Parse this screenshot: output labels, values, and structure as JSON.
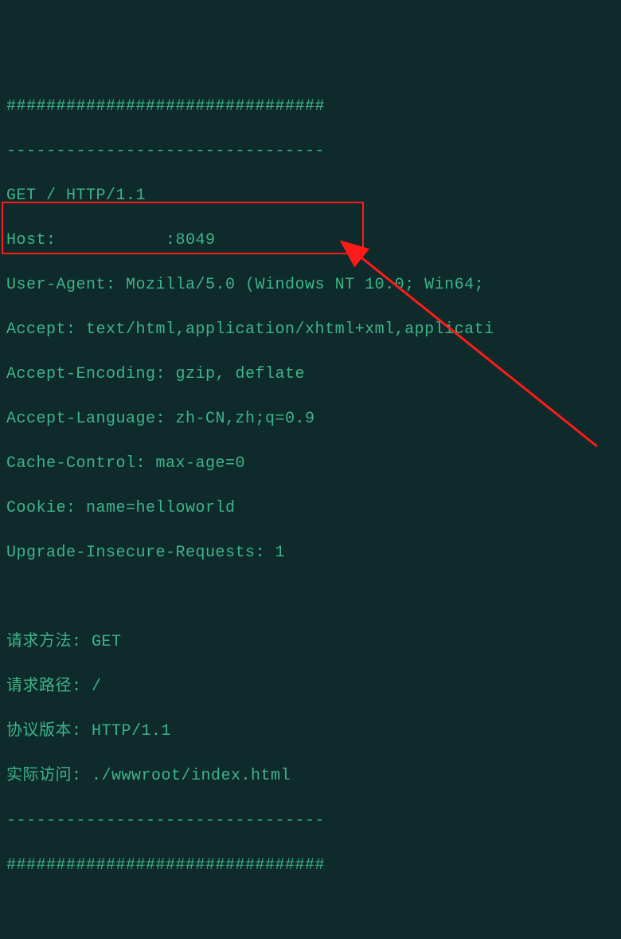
{
  "lines": {
    "sep_hash": "################################",
    "sep_dash": "--------------------------------",
    "request_line": "GET / HTTP/1.1",
    "host": "Host:           :8049",
    "user_agent": "User-Agent: Mozilla/5.0 (Windows NT 10.0; Win64; ",
    "accept": "Accept: text/html,application/xhtml+xml,applicati",
    "accept_encoding": "Accept-Encoding: gzip, deflate",
    "accept_language": "Accept-Language: zh-CN,zh;q=0.9",
    "cache_control": "Cache-Control: max-age=0",
    "cookie": "Cookie: name=helloworld",
    "upgrade": "Upgrade-Insecure-Requests: 1",
    "blank1": "",
    "blank2": "",
    "req_method": "请求方法: GET",
    "req_path": "请求路径: /",
    "proto_ver": "协议版本: HTTP/1.1",
    "actual_access": "实际访问: ./wwwroot/index.html"
  }
}
